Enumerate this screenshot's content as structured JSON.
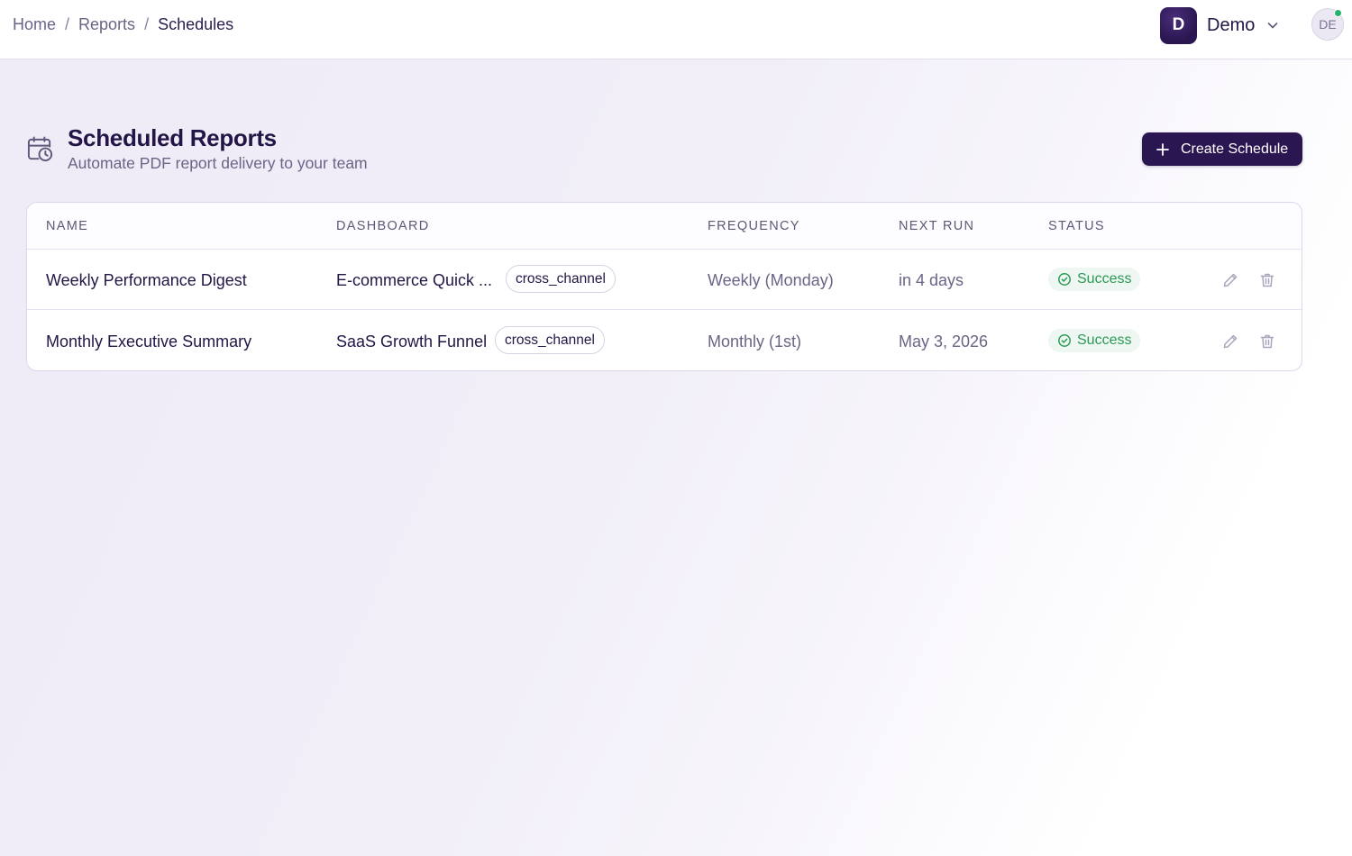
{
  "breadcrumb": {
    "items": [
      "Home",
      "Reports",
      "Schedules"
    ],
    "separator": "/"
  },
  "workspace": {
    "initial": "D",
    "name": "Demo"
  },
  "user": {
    "initials": "DE",
    "online": true
  },
  "header": {
    "icon": "calendar-clock-icon",
    "title": "Scheduled Reports",
    "subtitle": "Automate PDF report delivery to your team",
    "create_label": "Create Schedule"
  },
  "table": {
    "columns": [
      "NAME",
      "DASHBOARD",
      "FREQUENCY",
      "NEXT RUN",
      "STATUS"
    ],
    "rows": [
      {
        "name": "Weekly Performance Digest",
        "dashboard": "E-commerce Quick ...",
        "tag": "cross_channel",
        "frequency": "Weekly (Monday)",
        "next_run": "in 4 days",
        "status": "Success"
      },
      {
        "name": "Monthly Executive Summary",
        "dashboard": "SaaS Growth Funnel",
        "tag": "cross_channel",
        "frequency": "Monthly (1st)",
        "next_run": "May 3, 2026",
        "status": "Success"
      }
    ]
  },
  "colors": {
    "primary": "#2a1650",
    "success": "#2a9a55",
    "success_bg": "#eef7f1",
    "online": "#26b26a"
  }
}
